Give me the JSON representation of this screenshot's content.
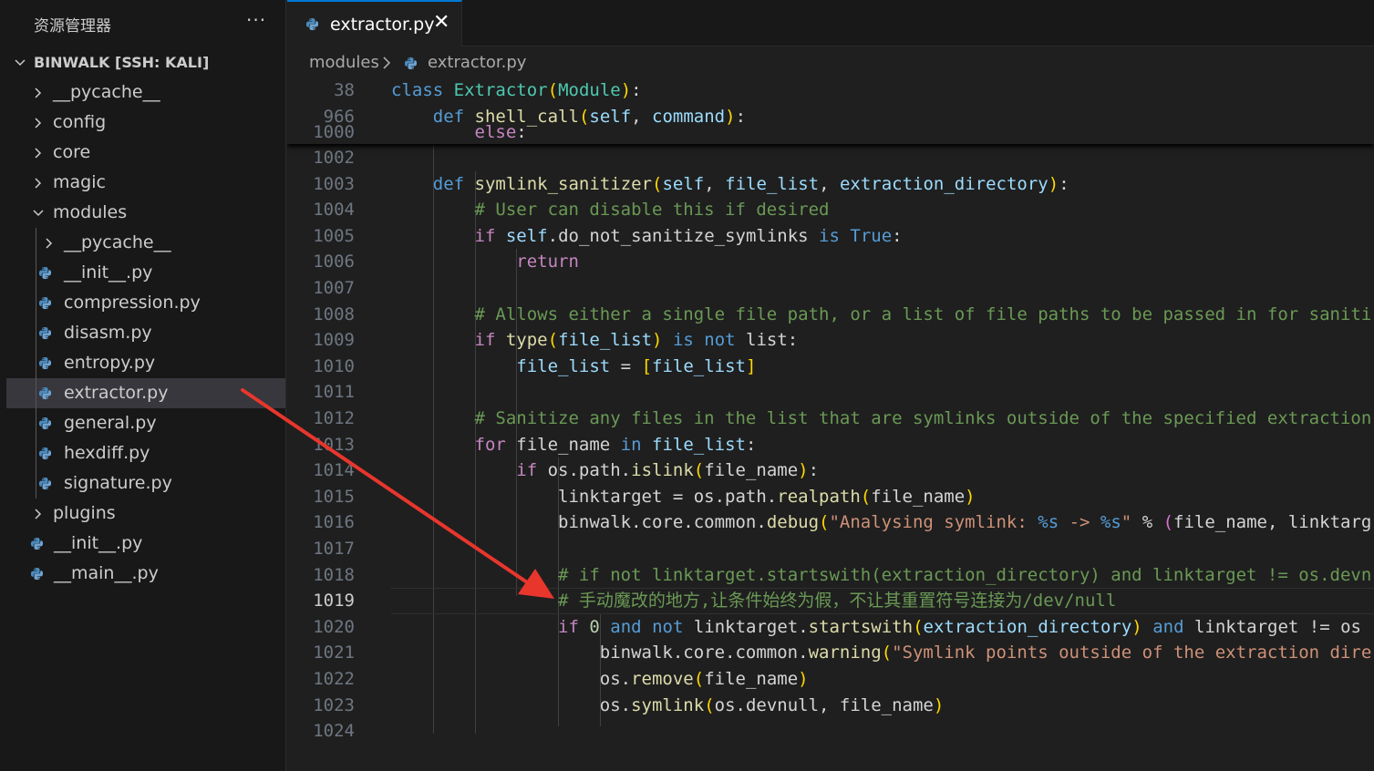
{
  "explorer": {
    "title": "资源管理器",
    "more": "···",
    "root": "BINWALK [SSH: KALI]",
    "items": [
      {
        "label": "__pycache__",
        "kind": "folder"
      },
      {
        "label": "config",
        "kind": "folder"
      },
      {
        "label": "core",
        "kind": "folder"
      },
      {
        "label": "magic",
        "kind": "folder"
      },
      {
        "label": "modules",
        "kind": "folder-open"
      },
      {
        "label": "__pycache__",
        "kind": "folder"
      },
      {
        "label": "__init__.py",
        "kind": "python"
      },
      {
        "label": "compression.py",
        "kind": "python"
      },
      {
        "label": "disasm.py",
        "kind": "python"
      },
      {
        "label": "entropy.py",
        "kind": "python"
      },
      {
        "label": "extractor.py",
        "kind": "python",
        "selected": true
      },
      {
        "label": "general.py",
        "kind": "python"
      },
      {
        "label": "hexdiff.py",
        "kind": "python"
      },
      {
        "label": "signature.py",
        "kind": "python"
      },
      {
        "label": "plugins",
        "kind": "folder"
      },
      {
        "label": "__init__.py",
        "kind": "python"
      },
      {
        "label": "__main__.py",
        "kind": "python"
      }
    ]
  },
  "editor": {
    "tab": {
      "label": "extractor.py",
      "close": "✕"
    },
    "breadcrumb": {
      "folder": "modules",
      "file": "extractor.py"
    },
    "sticky": [
      {
        "num": "38",
        "text": "class Extractor(Module):"
      },
      {
        "num": "966",
        "text": "    def shell_call(self, command):"
      },
      {
        "num": "1000",
        "text": "        else:"
      }
    ],
    "current_line": "1019",
    "lines": [
      {
        "num": "1002",
        "text": ""
      },
      {
        "num": "1003",
        "text": "    def symlink_sanitizer(self, file_list, extraction_directory):"
      },
      {
        "num": "1004",
        "text": "        # User can disable this if desired"
      },
      {
        "num": "1005",
        "text": "        if self.do_not_sanitize_symlinks is True:"
      },
      {
        "num": "1006",
        "text": "            return"
      },
      {
        "num": "1007",
        "text": ""
      },
      {
        "num": "1008",
        "text": "        # Allows either a single file path, or a list of file paths to be passed in for saniti"
      },
      {
        "num": "1009",
        "text": "        if type(file_list) is not list:"
      },
      {
        "num": "1010",
        "text": "            file_list = [file_list]"
      },
      {
        "num": "1011",
        "text": ""
      },
      {
        "num": "1012",
        "text": "        # Sanitize any files in the list that are symlinks outside of the specified extraction"
      },
      {
        "num": "1013",
        "text": "        for file_name in file_list:"
      },
      {
        "num": "1014",
        "text": "            if os.path.islink(file_name):"
      },
      {
        "num": "1015",
        "text": "                linktarget = os.path.realpath(file_name)"
      },
      {
        "num": "1016",
        "text": "                binwalk.core.common.debug(\"Analysing symlink: %s -> %s\" % (file_name, linktarg"
      },
      {
        "num": "1017",
        "text": ""
      },
      {
        "num": "1018",
        "text": "                # if not linktarget.startswith(extraction_directory) and linktarget != os.devn"
      },
      {
        "num": "1019",
        "text": "                # 手动魔改的地方,让条件始终为假，不让其重置符号连接为/dev/null"
      },
      {
        "num": "1020",
        "text": "                if 0 and not linktarget.startswith(extraction_directory) and linktarget != os"
      },
      {
        "num": "1021",
        "text": "                    binwalk.core.common.warning(\"Symlink points outside of the extraction dire"
      },
      {
        "num": "1022",
        "text": "                    os.remove(file_name)"
      },
      {
        "num": "1023",
        "text": "                    os.symlink(os.devnull, file_name)"
      },
      {
        "num": "1024",
        "text": ""
      }
    ]
  },
  "colors": {
    "keyword": "#569cd6",
    "control": "#c586c0",
    "class": "#4ec9b0",
    "function": "#dcdcaa",
    "param": "#9cdcfe",
    "comment": "#6a9955",
    "string": "#ce9178",
    "number": "#b5cea8",
    "arrow": "#e8362d",
    "selection": "#37373d",
    "tab_accent": "#0078d4"
  },
  "icons": {
    "python": "python-file-icon",
    "chevron": "chevron-icon"
  }
}
